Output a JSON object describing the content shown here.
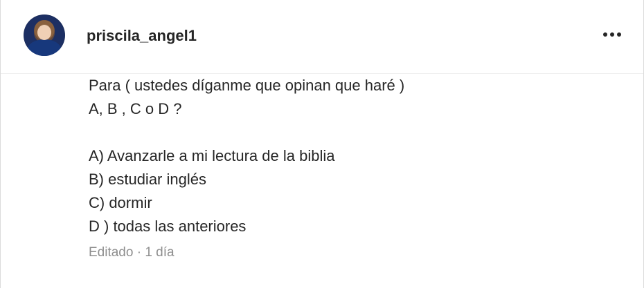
{
  "post": {
    "username": "priscila_angel1",
    "menu_icon": "more-options-icon",
    "caption_lines": [
      "Para ( ustedes díganme que opinan que haré )",
      "A, B , C o D ?",
      "",
      "A) Avanzarle a mi lectura de la biblia",
      "B) estudiar inglés",
      "C) dormir",
      "D ) todas las anteriores"
    ],
    "meta": "Editado · 1 día"
  }
}
